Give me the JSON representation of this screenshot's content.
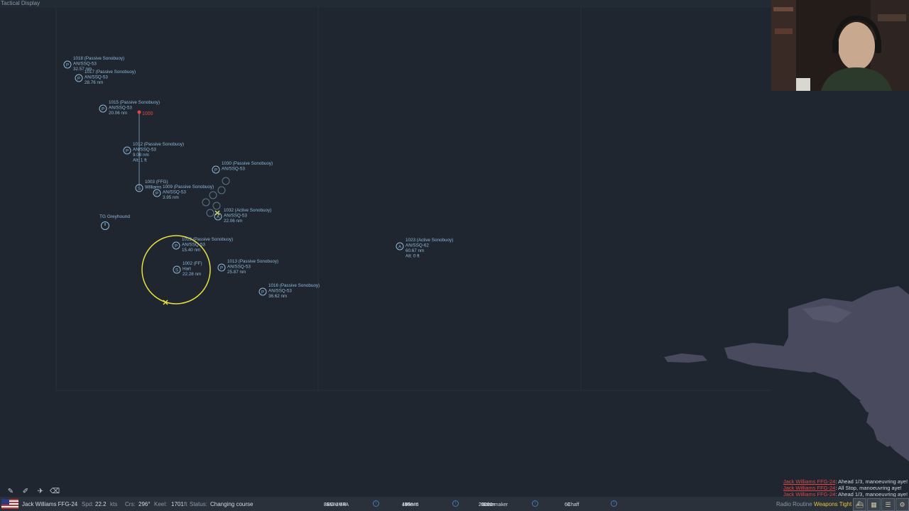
{
  "window": {
    "title": "Tactical Display"
  },
  "contacts": [
    {
      "type": "P",
      "name": "1018 (Passive Sonobuoy)",
      "sensor": "AN/SSQ-53",
      "range": "32.57 nm"
    },
    {
      "type": "P",
      "name": "1017 (Passive Sonobuoy)",
      "sensor": "AN/SSQ-53",
      "range": "28.76 nm"
    },
    {
      "type": "P",
      "name": "1015 (Passive Sonobuoy)",
      "sensor": "AN/SSQ-53",
      "range": "20.06 nm"
    },
    {
      "type": "P",
      "name": "1012 (Passive Sonobuoy)",
      "sensor": "AN/SSQ-53",
      "range": "9.08 nm",
      "alt": "Alt: 1 ft"
    },
    {
      "type": "P",
      "name": "1030 (Passive Sonobuoy)",
      "sensor": "AN/SSQ-53",
      "range": ""
    },
    {
      "type": "S",
      "name": "1003 (FFG)",
      "sensor": "Williams",
      "range": ""
    },
    {
      "type": "P",
      "name": "1009 (Passive Sonobuoy)",
      "sensor": "AN/SSQ-53",
      "range": "3.95 nm"
    },
    {
      "type": "P",
      "name": "1019 (Passive Sonobuoy)",
      "sensor": "AN/SSQ-53",
      "range": "15.40 nm"
    },
    {
      "type": "S",
      "name": "1002 (FF)",
      "sensor": "Hart",
      "range": "22.28 nm"
    },
    {
      "type": "P",
      "name": "1013 (Passive Sonobuoy)",
      "sensor": "AN/SSQ-53",
      "range": "25.87 nm"
    },
    {
      "type": "P",
      "name": "1016 (Passive Sonobuoy)",
      "sensor": "AN/SSQ-53",
      "range": "36.62 nm"
    },
    {
      "type": "A",
      "name": "1023 (Active Sonobuoy)",
      "sensor": "AN/SSQ-62",
      "range": "60.67 nm",
      "alt": "Alt: 0 ft"
    },
    {
      "type": "A",
      "name": "1032 (Active Sonobuoy)",
      "sensor": "AN/SSQ-53",
      "range": "22.06 nm"
    }
  ],
  "group": {
    "label": "TG Greyhound"
  },
  "status": {
    "unit": "Jack Williams FFG-24",
    "spd_label": "Spd:",
    "spd": "22.2",
    "spd_unit": "kts",
    "crs_label": "Crs:",
    "crs": "296°",
    "keel_label": "Keel:",
    "keel": "1701",
    "keel_unit": "ft",
    "status_label": "Status:",
    "status": "Changing course"
  },
  "weapons": [
    {
      "count1": "31",
      "name1": "SM-1MR",
      "count2": "8",
      "name2": "RGM-84A"
    },
    {
      "count1": "16",
      "name1": "Mk-46",
      "count2": "4998",
      "name2": "76mm"
    },
    {
      "count1": "20000",
      "name1": "20mm",
      "count2": "20",
      "name2": "Noisemaker"
    },
    {
      "count1": "68",
      "name1": "Chaff",
      "count2": "",
      "name2": ""
    }
  ],
  "log": [
    {
      "who": "Jack Williams FFG-24",
      "msg": ": Ahead 1/3, manoeuvring aye!"
    },
    {
      "who": "Jack Williams FFG-24",
      "msg": ": All Stop, manoeuvring aye!"
    },
    {
      "who": "Jack Williams FFG-24",
      "msg": ": Ahead 1/3, manoeuvring aye!"
    }
  ],
  "buttons": {
    "radio": "Radio Routine",
    "weapons": "Weapons Tight"
  },
  "colors": {
    "accent": "#8fb8d8",
    "warning": "#e04848",
    "selection": "#e8e040",
    "land": "#4a4a5e"
  }
}
